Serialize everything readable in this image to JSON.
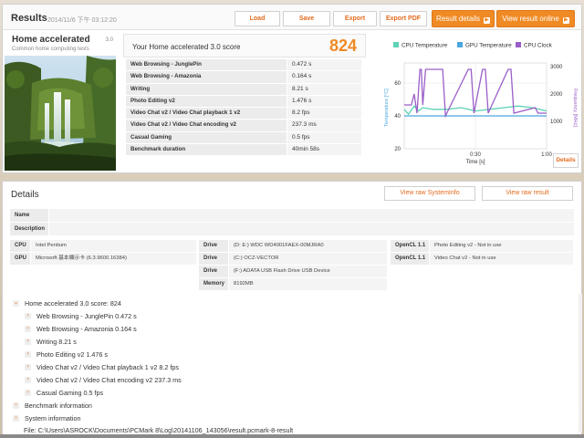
{
  "header": {
    "title": "Results",
    "date": "2014/11/6 下午 03:12:20",
    "load_label": "Load",
    "save_label": "Save",
    "export_label": "Export",
    "export_pdf_label": "Export PDF",
    "result_details_label": "Result details",
    "view_online_label": "View result online"
  },
  "benchmark": {
    "name": "Home accelerated",
    "version": "3.0",
    "subtitle": "Common home computing tests"
  },
  "score": {
    "label": "Your Home accelerated 3.0 score",
    "value": "824",
    "rows": [
      {
        "label": "Web Browsing - JunglePin",
        "value": "0.472 s"
      },
      {
        "label": "Web Browsing - Amazonia",
        "value": "0.164 s"
      },
      {
        "label": "Writing",
        "value": "8.21 s"
      },
      {
        "label": "Photo Editing v2",
        "value": "1.476 s"
      },
      {
        "label": "Video Chat v2 / Video Chat playback 1 v2",
        "value": "8.2 fps"
      },
      {
        "label": "Video Chat v2 / Video Chat encoding v2",
        "value": "237.3 ms"
      },
      {
        "label": "Casual Gaming",
        "value": "0.5 fps"
      },
      {
        "label": "Benchmark duration",
        "value": "40min 58s"
      }
    ]
  },
  "chart_details_label": "Details",
  "chart_data": {
    "type": "line",
    "legend_position": "top",
    "xlabel": "Time [s]",
    "ylabel_left": "Temperature [°C]",
    "ylabel_right": "Frequency [MHz]",
    "x_ticks": [
      "0:30",
      "1:00"
    ],
    "y_left_ticks": [
      20,
      40,
      60
    ],
    "y_right_ticks": [
      1000,
      2000,
      3000
    ],
    "ylim_left": [
      20,
      70
    ],
    "ylim_right": [
      0,
      3000
    ],
    "xlim": [
      0,
      1
    ],
    "grid": true,
    "series": [
      {
        "name": "CPU Temperature",
        "axis": "left",
        "color": "#5dd3b5",
        "x": [
          0,
          0.03,
          0.07,
          0.1,
          0.13,
          0.2,
          0.3,
          0.4,
          0.5,
          0.6,
          0.7,
          0.8,
          0.9,
          0.95,
          1.0
        ],
        "y": [
          44,
          41,
          46,
          43,
          45,
          44,
          44,
          45,
          43,
          44,
          45,
          46,
          45,
          44,
          43
        ]
      },
      {
        "name": "GPU Temperature",
        "axis": "left",
        "color": "#4aa6e0",
        "x": [
          0,
          0.1,
          0.2,
          0.3,
          0.4,
          0.5,
          0.6,
          0.7,
          0.8,
          0.9,
          1.0
        ],
        "y": [
          40,
          40,
          40,
          40,
          40,
          40,
          40,
          40,
          40,
          40,
          40
        ]
      },
      {
        "name": "CPU Clock",
        "axis": "right",
        "color": "#9a5ec8",
        "x": [
          0,
          0.05,
          0.07,
          0.09,
          0.11,
          0.12,
          0.13,
          0.15,
          0.25,
          0.27,
          0.29,
          0.45,
          0.47,
          0.49,
          0.55,
          0.57,
          0.59,
          0.73,
          0.75,
          0.77,
          0.92,
          0.94,
          1.0
        ],
        "y": [
          1600,
          1600,
          2000,
          1300,
          2900,
          2900,
          1600,
          2900,
          2900,
          2900,
          1200,
          2900,
          2900,
          1300,
          2900,
          2900,
          1300,
          2900,
          2900,
          1300,
          1500,
          1300,
          1300
        ]
      }
    ]
  },
  "details": {
    "title": "Details",
    "view_systeminfo_label": "View raw SystemInfo",
    "view_result_label": "View raw result",
    "name_label": "Name",
    "description_label": "Description",
    "cpu_label": "CPU",
    "cpu_value": "Intel Pentium",
    "gpu_label": "GPU",
    "gpu_value": "Microsoft 基本顯示卡 (6.3.9600.16384)",
    "drive_label": "Drive",
    "drives": [
      "(D: E:) WDC WD4001FAEX-00MJRA0",
      "(C:) OCZ-VECTOR",
      "(F:) ADATA USB Flash Drive USB Device"
    ],
    "memory_label": "Memory",
    "memory_value": "8192MB",
    "opencl_label": "OpenCL 1.1",
    "opencl_values": [
      "Photo Editing v2 - Not in use",
      "Video Chat v2 - Not in use"
    ]
  },
  "tree": {
    "root": "Home accelerated 3.0 score: 824",
    "children": [
      "Web Browsing - JunglePin 0.472 s",
      "Web Browsing - Amazonia 0.164 s",
      "Writing 8.21 s",
      "Photo Editing v2 1.476 s",
      "Video Chat v2 / Video Chat playback 1 v2 8.2 fps",
      "Video Chat v2 / Video Chat encoding v2 237.3 ms",
      "Casual Gaming 0.5 fps"
    ],
    "benchmark_info": "Benchmark information",
    "system_info": "System information",
    "file": "File: C:\\Users\\ASROCK\\Documents\\PCMark 8\\Log\\20141106_143056\\result.pcmark-8-result"
  },
  "icons": {
    "expand": "chevron-right-icon",
    "collapse": "chevron-down-icon",
    "arrow": "arrow-right-icon"
  }
}
